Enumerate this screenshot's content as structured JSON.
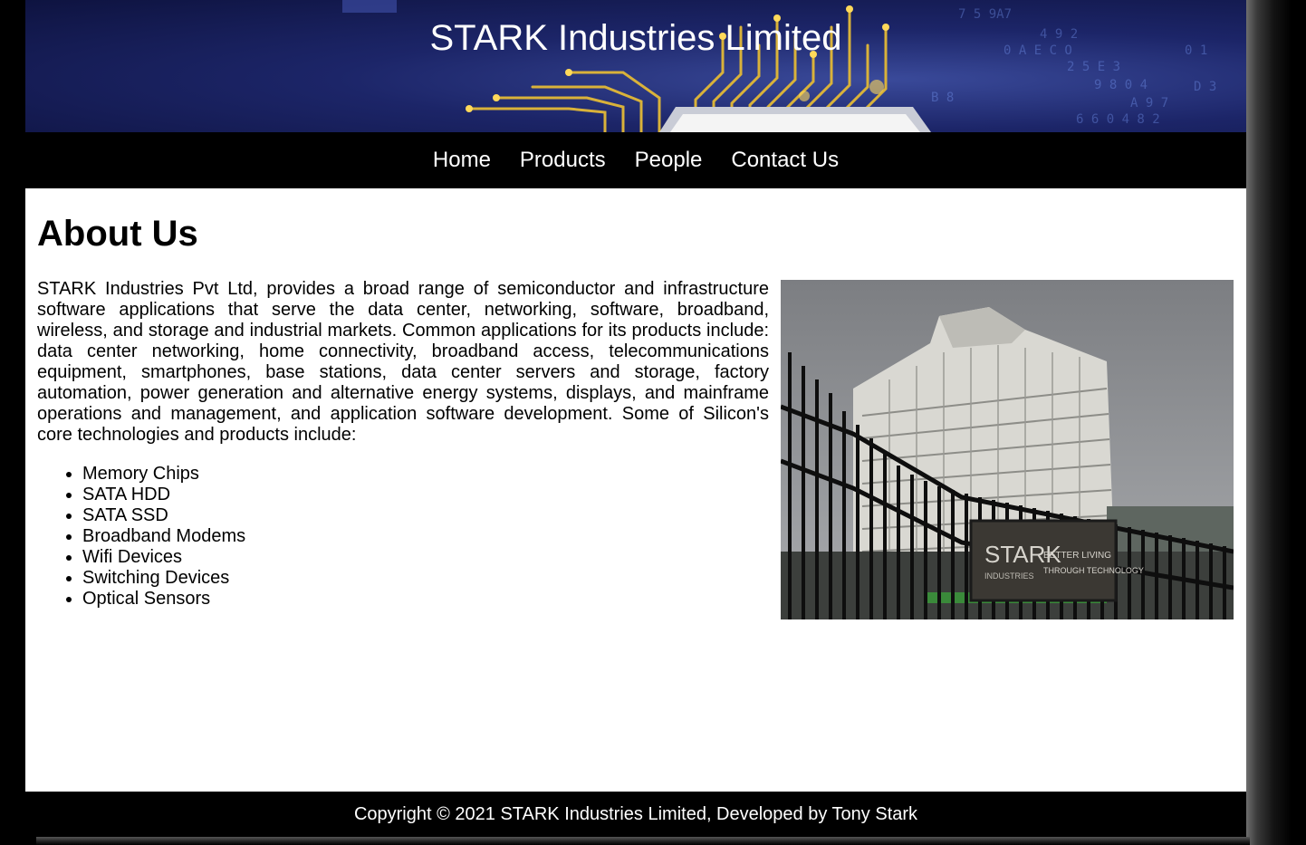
{
  "header": {
    "title": "STARK Industries Limited"
  },
  "nav": {
    "items": [
      "Home",
      "Products",
      "People",
      "Contact Us"
    ]
  },
  "main": {
    "heading": "About Us",
    "intro": "STARK Industries Pvt Ltd, provides a broad range of semiconductor and infrastructure software applications that serve the data center, networking, software, broadband, wireless, and storage and industrial markets. Common applications for its products include: data center networking, home connectivity, broadband access, telecommunications equipment, smartphones, base stations, data center servers and storage, factory automation, power generation and alternative energy systems, displays, and mainframe operations and management, and application software development. Some of Silicon's core technologies and products include:",
    "products": [
      "Memory Chips",
      "SATA HDD",
      "SATA SSD",
      "Broadband Modems",
      "Wifi Devices",
      "Switching Devices",
      "Optical Sensors"
    ],
    "image_sign": {
      "logo": "STARK",
      "sub": "INDUSTRIES",
      "tagline_1": "BETTER LIVING",
      "tagline_2": "THROUGH TECHNOLOGY"
    }
  },
  "footer": {
    "text": "Copyright © 2021 STARK Industries Limited, Developed by Tony Stark"
  },
  "colors": {
    "nav_bg": "#000000",
    "page_bg": "#ffffff",
    "text": "#000000",
    "banner_blue": "#1c2568",
    "circuit_gold": "#e8c23a"
  }
}
